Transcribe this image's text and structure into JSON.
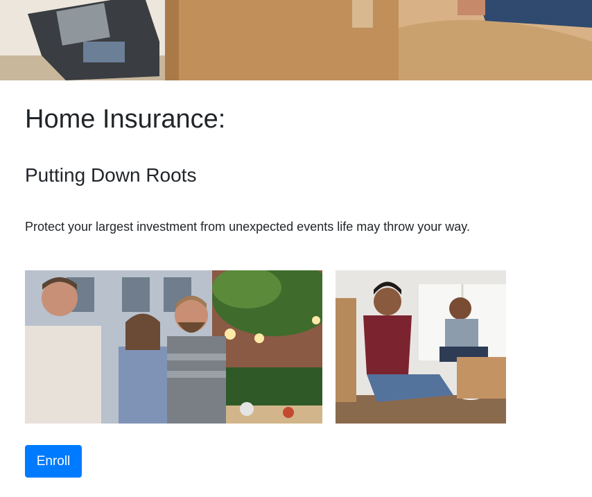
{
  "hero": {
    "image": "moving-boxes-hero-photo"
  },
  "heading": "Home Insurance:",
  "subheading": "Putting Down Roots",
  "description": "Protect your largest investment from unexpected events life may throw your way.",
  "gallery": [
    {
      "image": "friends-backyard-party-photo"
    },
    {
      "image": "couple-moving-in-photo"
    }
  ],
  "enroll_button": {
    "label": "Enroll"
  },
  "colors": {
    "primary": "#007bff",
    "text": "#212529",
    "background": "#ffffff"
  }
}
